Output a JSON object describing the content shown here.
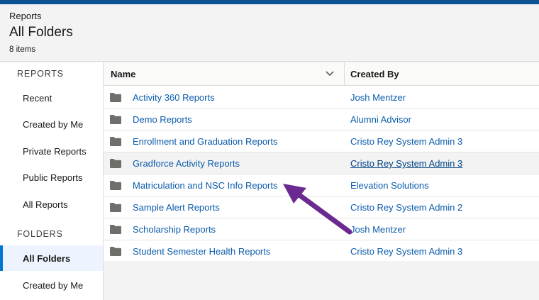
{
  "header": {
    "breadcrumb": "Reports",
    "title": "All Folders",
    "item_count": "8 items"
  },
  "sidebar": {
    "reports_section": "REPORTS",
    "report_items": [
      {
        "label": "Recent"
      },
      {
        "label": "Created by Me"
      },
      {
        "label": "Private Reports"
      },
      {
        "label": "Public Reports"
      },
      {
        "label": "All Reports"
      }
    ],
    "folders_section": "FOLDERS",
    "folder_items": [
      {
        "label": "All Folders",
        "active": true
      },
      {
        "label": "Created by Me"
      }
    ]
  },
  "table": {
    "columns": {
      "name": "Name",
      "created_by": "Created By"
    },
    "rows": [
      {
        "name": "Activity 360 Reports",
        "created_by": "Josh Mentzer"
      },
      {
        "name": "Demo Reports",
        "created_by": "Alumni Advisor"
      },
      {
        "name": "Enrollment and Graduation Reports",
        "created_by": "Cristo Rey System Admin 3"
      },
      {
        "name": "Gradforce Activity Reports",
        "created_by": "Cristo Rey System Admin 3",
        "hovered": true
      },
      {
        "name": "Matriculation and NSC Info Reports",
        "created_by": "Elevation Solutions"
      },
      {
        "name": "Sample Alert Reports",
        "created_by": "Cristo Rey System Admin 2"
      },
      {
        "name": "Scholarship Reports",
        "created_by": "Josh Mentzer"
      },
      {
        "name": "Student Semester Health Reports",
        "created_by": "Cristo Rey System Admin 3"
      }
    ]
  },
  "icons": {
    "folder": "folder-icon",
    "sort": "chevron-down-icon"
  },
  "colors": {
    "brand_bar": "#0a5294",
    "link": "#0b5cab",
    "active_indicator": "#0176d3",
    "annotation_arrow": "#6b2a91"
  }
}
